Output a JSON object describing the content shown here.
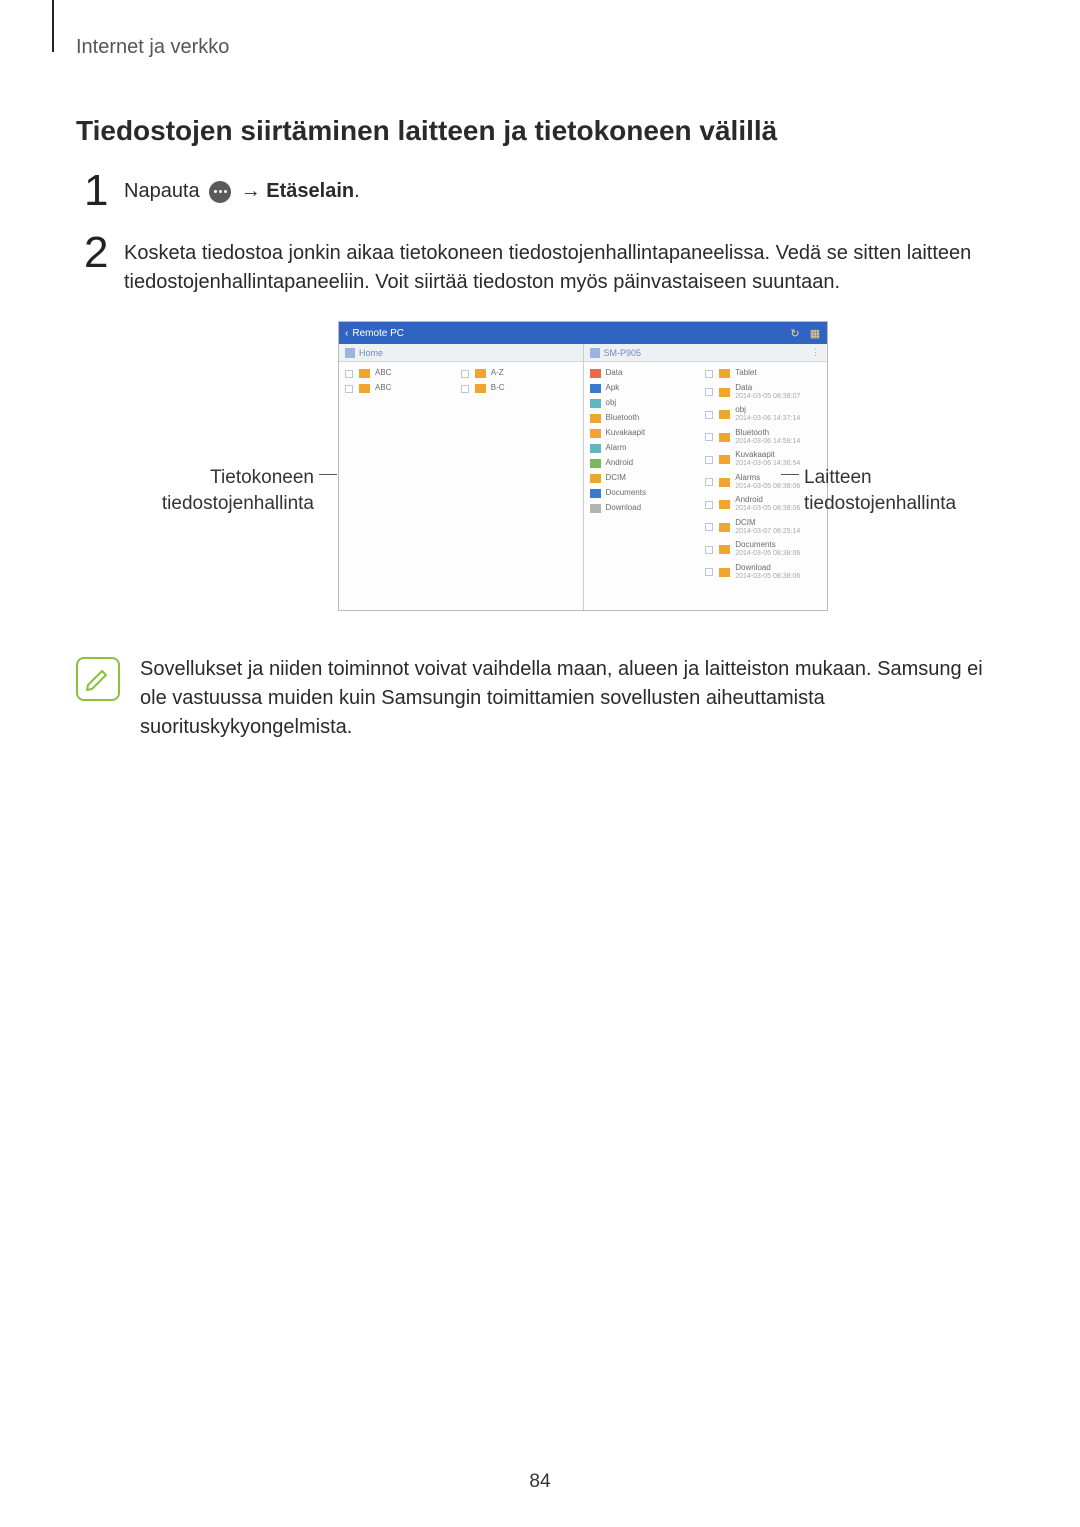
{
  "breadcrumb": "Internet ja verkko",
  "section_title": "Tiedostojen siirtäminen laitteen ja tietokoneen välillä",
  "steps": {
    "s1": {
      "num": "1",
      "prefix": "Napauta ",
      "arrow": " → ",
      "bold": "Etäselain",
      "suffix": "."
    },
    "s2": {
      "num": "2",
      "text": "Kosketa tiedostoa jonkin aikaa tietokoneen tiedostojenhallintapaneelissa. Vedä se sitten laitteen tiedostojenhallintapaneeliin. Voit siirtää tiedoston myös päinvastaiseen suuntaan."
    }
  },
  "callouts": {
    "left_line1": "Tietokoneen",
    "left_line2": "tiedostojenhallinta",
    "right_line1": "Laitteen",
    "right_line2": "tiedostojenhallinta"
  },
  "device": {
    "titlebar": "Remote PC",
    "pc_header": "Home",
    "dev_header": "SM-P905",
    "pc_items": [
      {
        "chk": true,
        "name": "ABC"
      },
      {
        "chk": true,
        "name": "ABC"
      },
      {
        "chk": false,
        "name": "A-Z"
      },
      {
        "chk": false,
        "name": "B-C"
      }
    ],
    "dev_left": [
      {
        "c": "red",
        "t": "Data"
      },
      {
        "c": "blue",
        "t": "Apk"
      },
      {
        "c": "teal",
        "t": "obj"
      },
      {
        "c": "orange",
        "t": "Bluetooth"
      },
      {
        "c": "orange",
        "t": "Kuvakaapit"
      },
      {
        "c": "teal",
        "t": "Alarm"
      },
      {
        "c": "green",
        "t": "Android"
      },
      {
        "c": "orange",
        "t": "DCIM"
      },
      {
        "c": "blue",
        "t": "Documents"
      },
      {
        "c": "grey",
        "t": "Download"
      }
    ],
    "dev_right": [
      {
        "c": "orange",
        "t": "Tablet"
      },
      {
        "c": "orange",
        "t": "Data",
        "sub": "2014-03-05 08:38:07"
      },
      {
        "c": "orange",
        "t": "obj",
        "sub": "2014-03-06 14:37:14"
      },
      {
        "c": "orange",
        "t": "Bluetooth",
        "sub": "2014-03-06 14:59:14"
      },
      {
        "c": "orange",
        "t": "Kuvakaapit",
        "sub": "2014-03-06 14:36:54"
      },
      {
        "c": "orange",
        "t": "Alarms",
        "sub": "2014-03-05 08:38:06"
      },
      {
        "c": "orange",
        "t": "Android",
        "sub": "2014-03-05 08:38:06"
      },
      {
        "c": "orange",
        "t": "DCIM",
        "sub": "2014-03-07 08:25:14"
      },
      {
        "c": "orange",
        "t": "Documents",
        "sub": "2014-03-05 08:38:06"
      },
      {
        "c": "orange",
        "t": "Download",
        "sub": "2014-03-05 08:38:06"
      }
    ]
  },
  "note": "Sovellukset ja niiden toiminnot voivat vaihdella maan, alueen ja laitteiston mukaan. Samsung ei ole vastuussa muiden kuin Samsungin toimittamien sovellusten aiheuttamista suorituskykyongelmista.",
  "page_number": "84"
}
